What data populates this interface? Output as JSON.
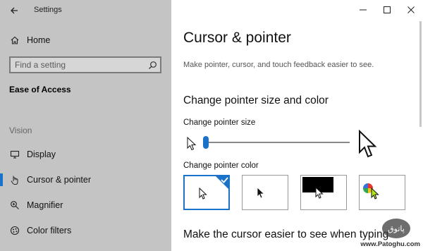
{
  "window": {
    "title": "Settings",
    "controls": [
      "minimize-icon",
      "maximize-icon",
      "close-icon"
    ]
  },
  "sidebar": {
    "home_label": "Home",
    "search_placeholder": "Find a setting",
    "category": "Ease of Access",
    "section_label": "Vision",
    "items": [
      {
        "label": "Display",
        "icon": "display-icon"
      },
      {
        "label": "Cursor & pointer",
        "icon": "cursor-pointer-icon",
        "selected": true
      },
      {
        "label": "Magnifier",
        "icon": "magnifier-icon"
      },
      {
        "label": "Color filters",
        "icon": "color-filters-icon"
      }
    ]
  },
  "main": {
    "title": "Cursor & pointer",
    "description": "Make pointer, cursor, and touch feedback easier to see.",
    "section1_heading": "Change pointer size and color",
    "size_label": "Change pointer size",
    "pointer_size_fraction": 0.02,
    "color_label": "Change pointer color",
    "color_options": [
      {
        "name": "white",
        "selected": true
      },
      {
        "name": "black",
        "selected": false
      },
      {
        "name": "inverted",
        "selected": false
      },
      {
        "name": "custom",
        "selected": false
      }
    ],
    "section2_heading": "Make the cursor easier to see when typing"
  },
  "watermark": {
    "logo_text": "پاتوق",
    "site": "www.Patoghu.com"
  },
  "colors": {
    "accent": "#1a73c9",
    "sidebar_bg": "#c4c4c4"
  }
}
